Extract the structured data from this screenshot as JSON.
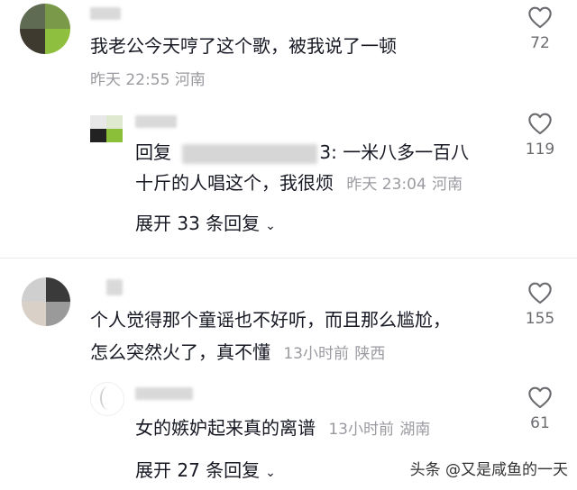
{
  "comments": [
    {
      "text": "我老公今天哼了这个歌，被我说了一顿",
      "time": "昨天 22:55",
      "location": "河南",
      "likes": "72",
      "reply": {
        "prefix": "回复",
        "target_tail": "3:",
        "text_line1": "一米八多一百八",
        "text_line2": "十斤的人唱这个，我很烦",
        "time": "昨天 23:04",
        "location": "河南",
        "likes": "119"
      },
      "expand_label": "展开 33 条回复"
    },
    {
      "text_line1": "个人觉得那个童谣也不好听，而且那么尴尬，",
      "text_line2": "怎么突然火了，真不懂",
      "time": "13小时前",
      "location": "陕西",
      "likes": "155",
      "reply": {
        "text": "女的嫉妒起来真的离谱",
        "time": "13小时前",
        "location": "湖南",
        "likes": "61"
      },
      "expand_label": "展开 27 条回复"
    }
  ],
  "watermark": "头条 @又是咸鱼的一天",
  "colors": {
    "text": "#161823",
    "meta": "#9a9aa0",
    "icon": "#6b6b70"
  },
  "icons": {
    "like": "heart-outline-icon",
    "expand": "chevron-down-icon"
  }
}
